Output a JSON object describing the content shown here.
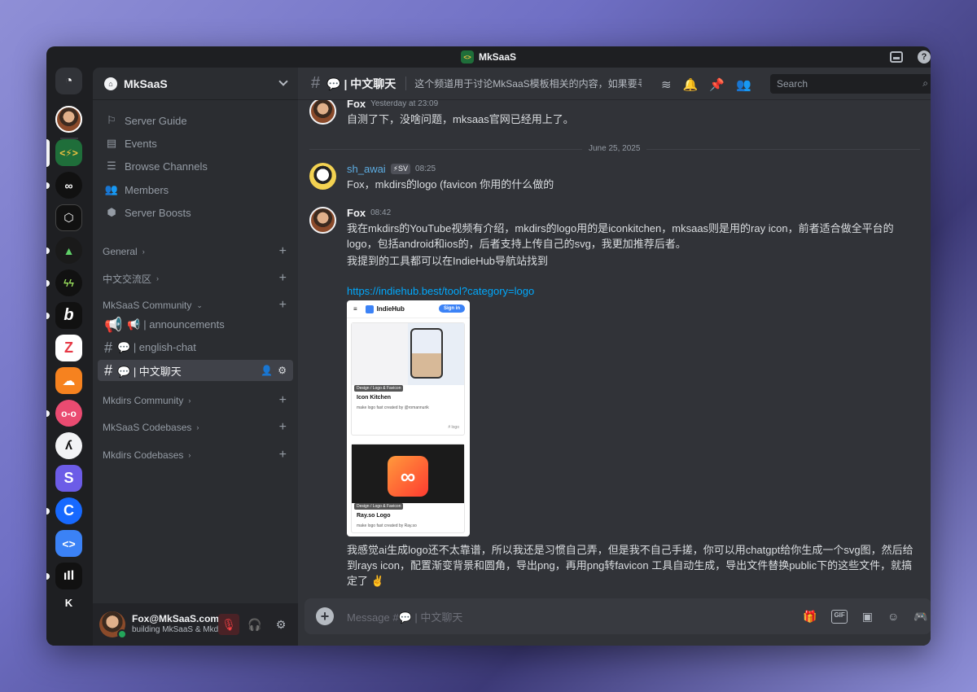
{
  "window": {
    "title": "MkSaaS"
  },
  "server": {
    "name": "MkSaaS"
  },
  "nav_items": [
    {
      "label": "Server Guide",
      "icon": "signpost-icon"
    },
    {
      "label": "Events",
      "icon": "calendar-icon"
    },
    {
      "label": "Browse Channels",
      "icon": "browse-icon"
    },
    {
      "label": "Members",
      "icon": "members-icon"
    },
    {
      "label": "Server Boosts",
      "icon": "boost-icon"
    }
  ],
  "categories": {
    "general": "General",
    "zh": "中文交流区",
    "community": "MkSaaS Community",
    "mkdirs_community": "Mkdirs Community",
    "mksaas_codebases": "MkSaaS Codebases",
    "mkdirs_codebases": "Mkdirs Codebases"
  },
  "channels": [
    {
      "label": "📢 | announcements",
      "active": false
    },
    {
      "label": "💬 | english-chat",
      "active": false
    },
    {
      "label": "💬 | 中文聊天",
      "active": true
    }
  ],
  "user": {
    "name": "Fox@MkSaaS.com",
    "status": "building MkSaaS & Mkdirs"
  },
  "channel_header": {
    "name": "💬 | 中文聊天",
    "topic": "这个频道用于讨论MkSaaS模板相关的内容，如果要寻..."
  },
  "search": {
    "placeholder": "Search"
  },
  "messages": [
    {
      "author": "Fox",
      "time": "Yesterday at 23:09",
      "text": "自测了下，没啥问题，mksaas官网已经用上了。"
    },
    {
      "author": "sh_awai",
      "tag": "⚡SV",
      "time": "08:25",
      "text": "Fox，mkdirs的logo (favicon 你用的什么做的"
    },
    {
      "author": "Fox",
      "time": "08:42",
      "text": "我在mkdirs的YouTube视频有介绍，mkdirs的logo用的是iconkitchen，mksaas则是用的ray icon，前者适合做全平台的logo，包括android和ios的，后者支持上传自己的svg，我更加推荐后者。",
      "text2": "我提到的工具都可以在IndieHub导航站找到",
      "link": "https://indiehub.best/tool?category=logo",
      "text3": "我感觉ai生成logo还不太靠谱，所以我还是习惯自己弄，但是我不自己手搓，你可以用chatgpt给你生成一个svg图，然后给到rays icon，配置渐变背景和圆角，导出png，再用png转favicon 工具自动生成，导出文件替换public下的这些文件，就搞定了 ✌️"
    }
  ],
  "date_divider": "June 25, 2025",
  "embed": {
    "brand": "IndieHub",
    "signin": "Sign in",
    "card1": {
      "pill": "Design / Logo & Favicon",
      "title": "Icon Kitchen",
      "desc": "make logo fast created by @romannurik",
      "tag": "# logo"
    },
    "card2": {
      "pill": "Design / Logo & Favicon",
      "title": "Ray.so Logo",
      "desc": "make logo fast created by Ray.so"
    }
  },
  "composer": {
    "placeholder": "Message #💬 | 中文聊天"
  },
  "colors": {
    "accent": "#5865f2",
    "online": "#23a55a",
    "link": "#00a8fc",
    "muted": "#f23f43"
  }
}
